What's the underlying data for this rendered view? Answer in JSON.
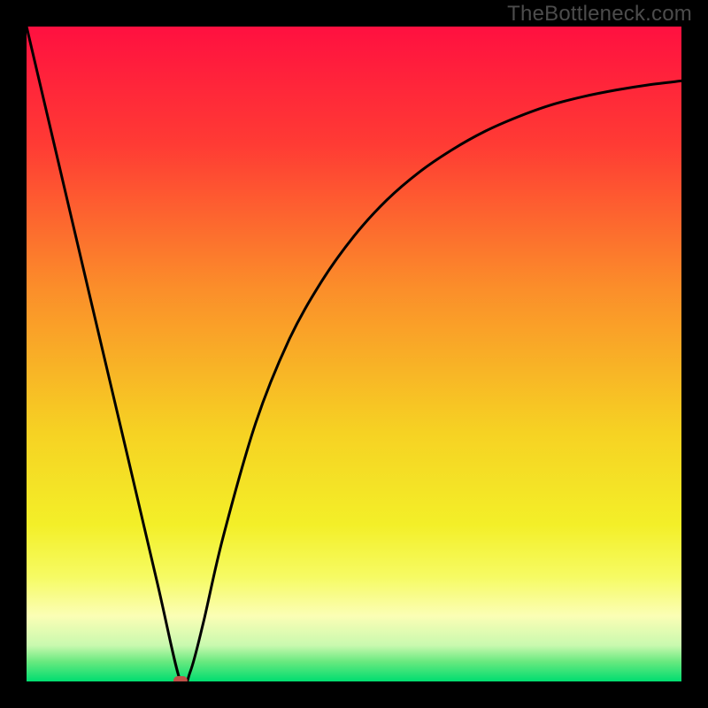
{
  "watermark": "TheBottleneck.com",
  "colors": {
    "background": "#000000",
    "curve_stroke": "#000000",
    "marker_fill": "#c05048",
    "gradient_stops": [
      {
        "offset": 0.0,
        "color": "#ff1040"
      },
      {
        "offset": 0.18,
        "color": "#ff3b34"
      },
      {
        "offset": 0.4,
        "color": "#fb8e2a"
      },
      {
        "offset": 0.62,
        "color": "#f6d223"
      },
      {
        "offset": 0.76,
        "color": "#f3ef28"
      },
      {
        "offset": 0.84,
        "color": "#f6fb63"
      },
      {
        "offset": 0.9,
        "color": "#fbfeb5"
      },
      {
        "offset": 0.945,
        "color": "#c9f9af"
      },
      {
        "offset": 0.97,
        "color": "#68e97f"
      },
      {
        "offset": 1.0,
        "color": "#00dd70"
      }
    ]
  },
  "chart_data": {
    "type": "line",
    "title": "",
    "xlabel": "",
    "ylabel": "",
    "xlim": [
      0,
      1
    ],
    "ylim": [
      0,
      1
    ],
    "series": [
      {
        "name": "curve",
        "x": [
          0.0,
          0.05,
          0.1,
          0.15,
          0.2,
          0.235,
          0.25,
          0.27,
          0.3,
          0.35,
          0.4,
          0.45,
          0.5,
          0.55,
          0.6,
          0.65,
          0.7,
          0.75,
          0.8,
          0.85,
          0.9,
          0.95,
          1.0
        ],
        "y": [
          1.0,
          0.787,
          0.574,
          0.362,
          0.149,
          0.0,
          0.015,
          0.09,
          0.22,
          0.395,
          0.52,
          0.61,
          0.68,
          0.735,
          0.778,
          0.812,
          0.84,
          0.862,
          0.88,
          0.893,
          0.903,
          0.911,
          0.917
        ]
      }
    ],
    "marker": {
      "x": 0.235,
      "y": 0.0
    }
  }
}
